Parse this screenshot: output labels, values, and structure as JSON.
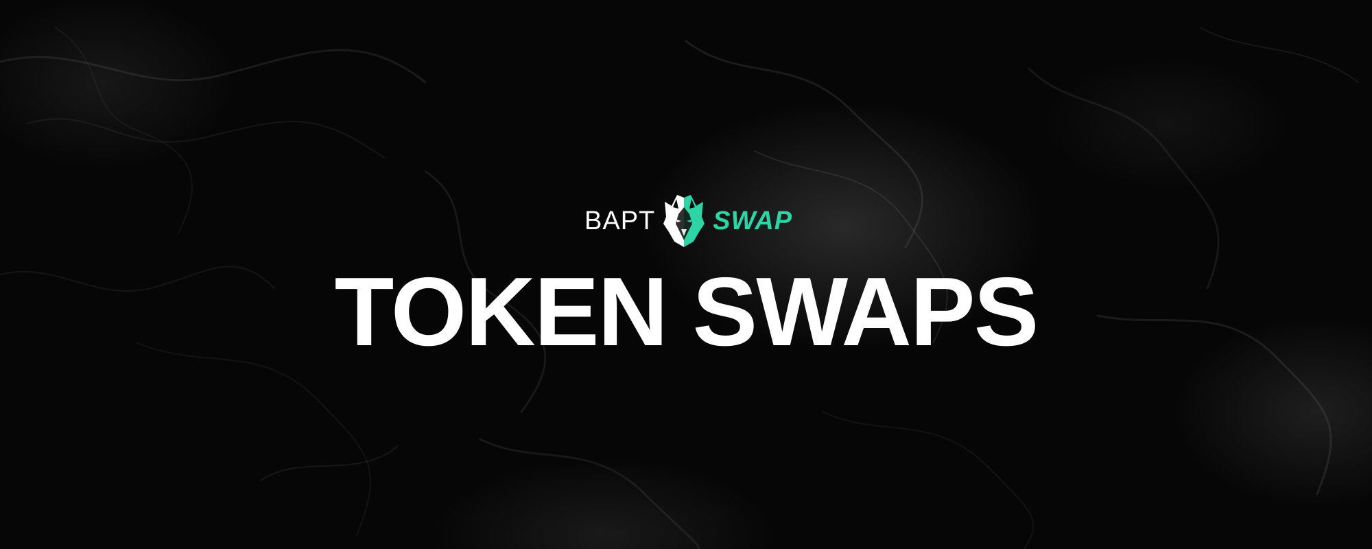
{
  "brand": {
    "prefix": "BAPT",
    "suffix": "SWAP",
    "icon": "wolf-head-icon",
    "accent_color": "#2ed3a6"
  },
  "headline": "TOKEN SWAPS",
  "background": {
    "style": "black marble texture",
    "color": "#060606"
  }
}
